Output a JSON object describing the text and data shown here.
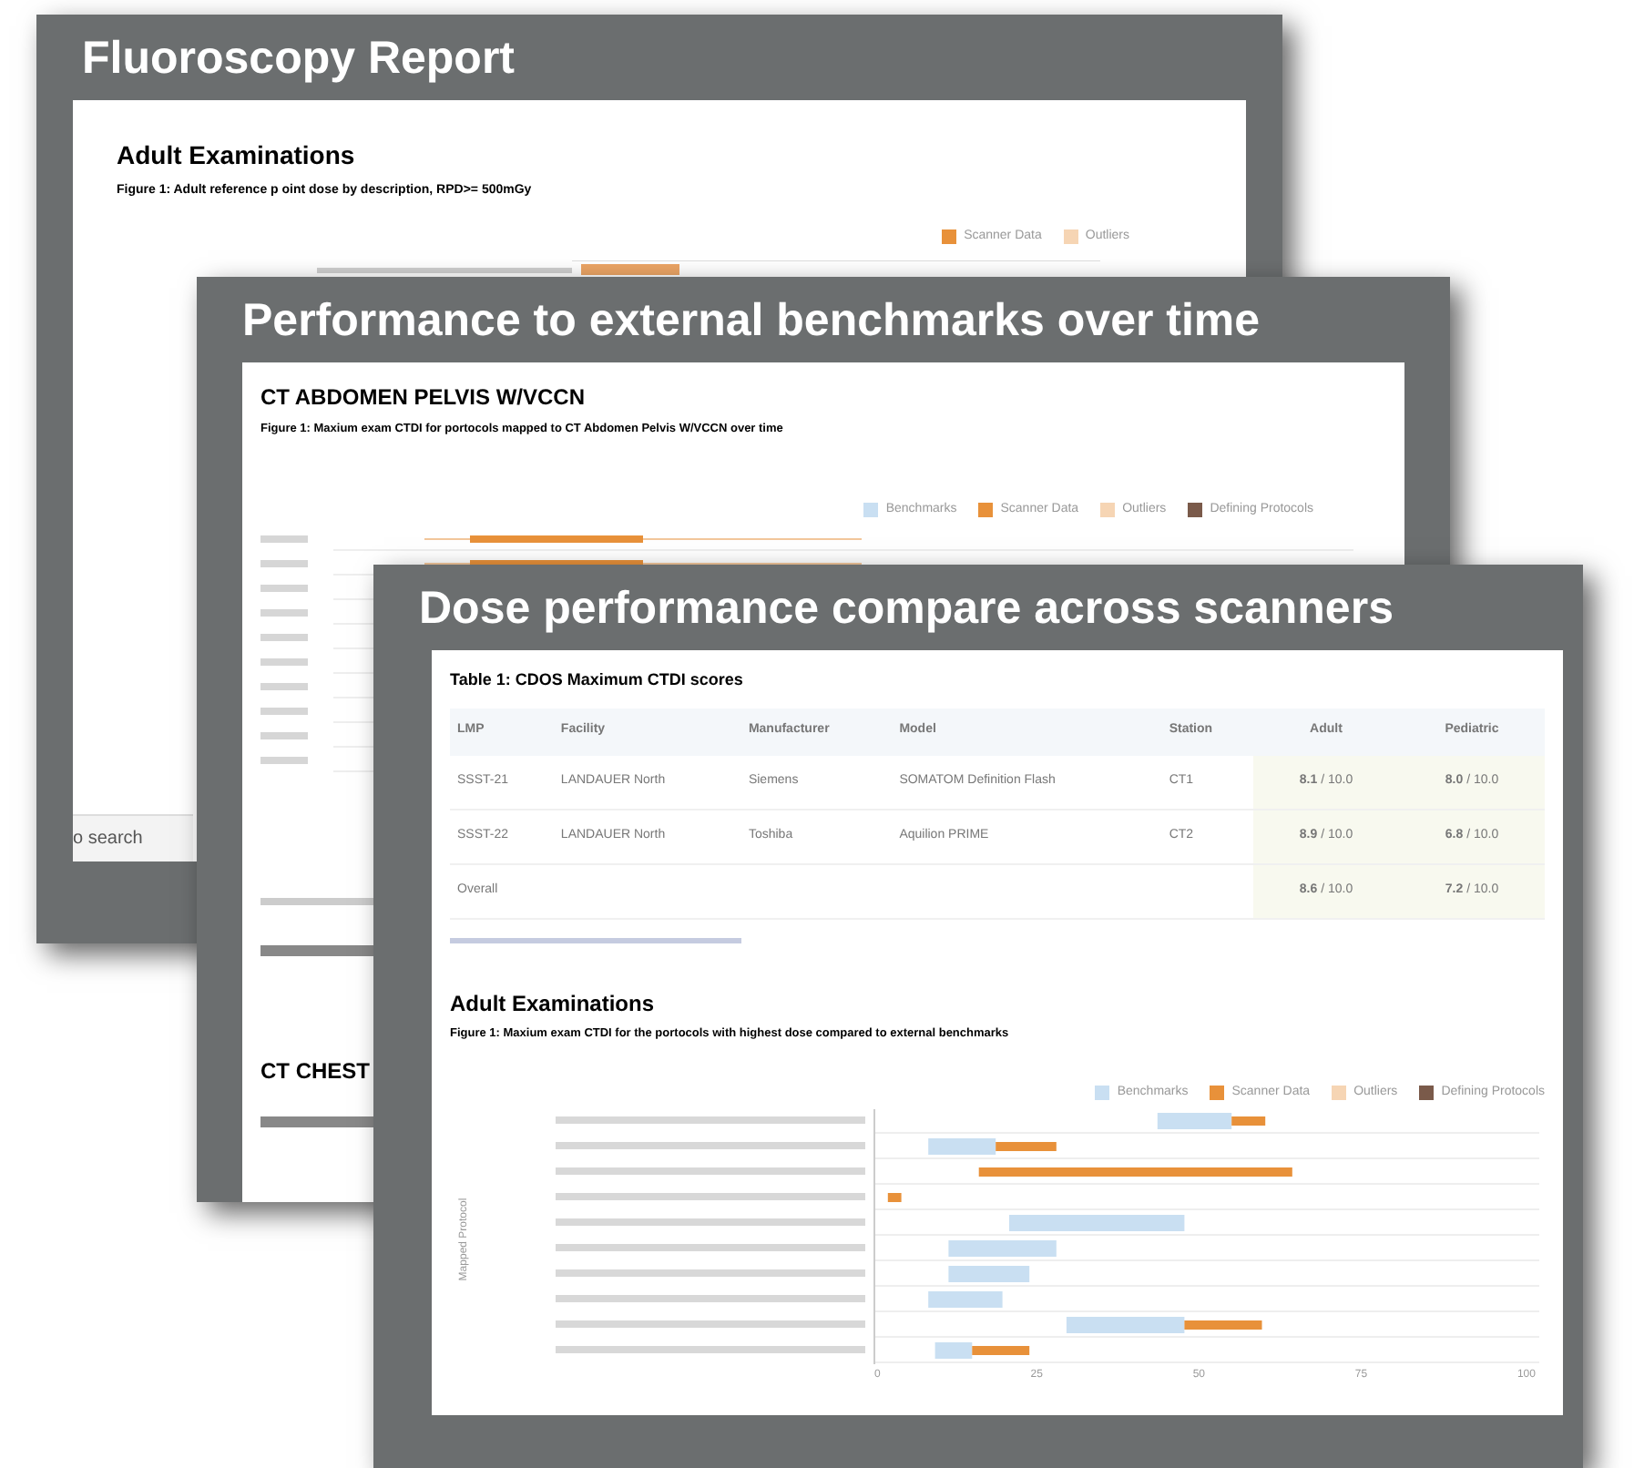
{
  "fluoroscopy_report": {
    "title": "Fluoroscopy Report",
    "heading": "Adult Examinations",
    "caption": "Figure 1: Adult reference p oint dose by description, RPD>= 500mGy",
    "legend": [
      {
        "label": "Scanner Data",
        "color": "#e8913a"
      },
      {
        "label": "Outliers",
        "color": "#f6d5b4"
      }
    ],
    "footer_text": "o search"
  },
  "benchmarks_over_time": {
    "title": "Performance to external benchmarks over time",
    "heading": "CT ABDOMEN PELVIS W/VCCN",
    "caption": "Figure 1: Maxium exam CTDI for portocols mapped to CT Abdomen Pelvis W/VCCN over time",
    "legend": [
      {
        "label": "Benchmarks",
        "color": "#c9dff2"
      },
      {
        "label": "Scanner Data",
        "color": "#e8913a"
      },
      {
        "label": "Outliers",
        "color": "#f6d5b4"
      },
      {
        "label": "Defining Protocols",
        "color": "#7a5a4a"
      }
    ],
    "section_heading": "CT CHEST"
  },
  "scanner_comparison": {
    "title": "Dose performance compare across scanners",
    "table_title": "Table 1: CDOS Maximum CTDI scores",
    "table": {
      "columns": [
        "LMP",
        "Facility",
        "Manufacturer",
        "Model",
        "Station",
        "Adult",
        "Pediatric"
      ],
      "rows": [
        [
          "SSST-21",
          "LANDAUER North",
          "Siemens",
          "SOMATOM Definition Flash",
          "CT1",
          "**8.1** / 10.0",
          "**8.0** / 10.0"
        ],
        [
          "SSST-22",
          "LANDAUER North",
          "Toshiba",
          "Aquilion PRIME",
          "CT2",
          "**8.9** / 10.0",
          "**6.8** / 10.0"
        ],
        [
          "Overall",
          "",
          "",
          "",
          "",
          "**8.6** / 10.0",
          "**7.2** / 10.0"
        ]
      ]
    },
    "heading": "Adult Examinations",
    "caption": "Figure 1: Maxium exam CTDI for the portocols with highest dose compared to external benchmarks",
    "legend": [
      {
        "label": "Benchmarks",
        "color": "#c9dff2"
      },
      {
        "label": "Scanner Data",
        "color": "#e8913a"
      },
      {
        "label": "Outliers",
        "color": "#f6d5b4"
      },
      {
        "label": "Defining Protocols",
        "color": "#7a5a4a"
      }
    ],
    "y_axis_label": "Mapped Protocol",
    "x_ticks": [
      "0",
      "25",
      "50",
      "75",
      "100"
    ]
  }
}
